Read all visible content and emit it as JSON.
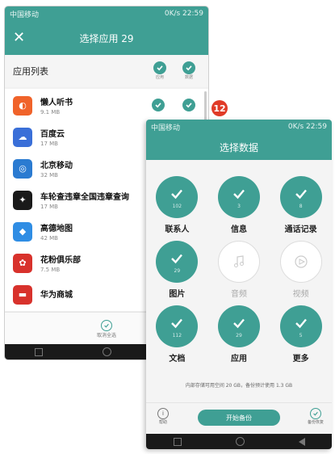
{
  "badge": "12",
  "back": {
    "status_left": "中国移动",
    "status_right": "0K/s 22:59",
    "title": "选择应用 29",
    "list_header": "应用列表",
    "toggle_labels": [
      "应用",
      "数据"
    ],
    "apps": [
      {
        "name": "懒人听书",
        "size": "9.1 MB",
        "color": "#f0632a",
        "glyph": "◐"
      },
      {
        "name": "百度云",
        "size": "17 MB",
        "color": "#3a6fd8",
        "glyph": "☁"
      },
      {
        "name": "北京移动",
        "size": "32 MB",
        "color": "#2b7bd1",
        "glyph": "◎"
      },
      {
        "name": "车轮查违章全国违章查询",
        "size": "17 MB",
        "color": "#1a1a1a",
        "glyph": "✦"
      },
      {
        "name": "高德地图",
        "size": "42 MB",
        "color": "#2f8de4",
        "glyph": "◆"
      },
      {
        "name": "花粉俱乐部",
        "size": "7.5 MB",
        "color": "#d8322c",
        "glyph": "✿"
      },
      {
        "name": "华为商城",
        "size": "",
        "color": "#d8322c",
        "glyph": "▬"
      }
    ],
    "bottom_label": "取消全选"
  },
  "front": {
    "status_left": "中国移动",
    "status_right": "0K/s 22:59",
    "title": "选择数据",
    "items": [
      {
        "label": "联系人",
        "count": "102",
        "on": true
      },
      {
        "label": "信息",
        "count": "3",
        "on": true
      },
      {
        "label": "通话记录",
        "count": "8",
        "on": true
      },
      {
        "label": "图片",
        "count": "29",
        "on": true
      },
      {
        "label": "音频",
        "count": "",
        "on": false
      },
      {
        "label": "视频",
        "count": "",
        "on": false
      },
      {
        "label": "文档",
        "count": "112",
        "on": true
      },
      {
        "label": "应用",
        "count": "29",
        "on": true
      },
      {
        "label": "更多",
        "count": "5",
        "on": true
      }
    ],
    "storage_text": "内部存储可用空间 20 GB，备份预计使用 1.3 GB",
    "start_button": "开始备份",
    "help_label": "帮助",
    "save_label": "备份恢复"
  }
}
